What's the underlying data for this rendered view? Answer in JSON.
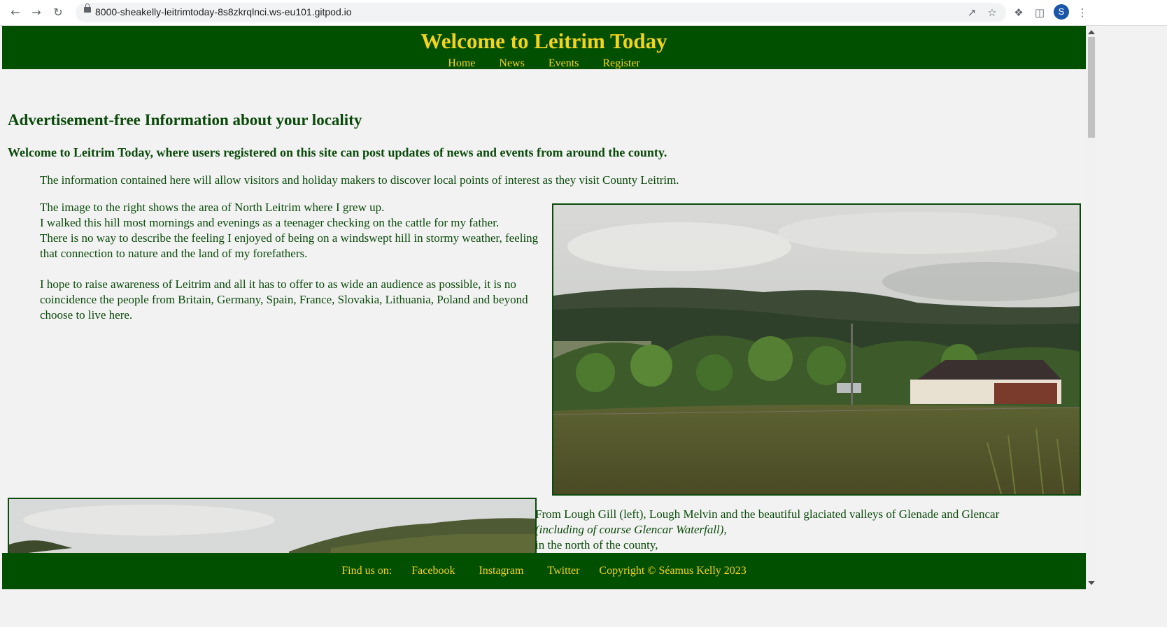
{
  "browser": {
    "url": "8000-sheakelly-leitrimtoday-8s8zkrqlnci.ws-eu101.gitpod.io",
    "avatar_letter": "S",
    "icons": [
      "back-icon",
      "forward-icon",
      "reload-icon",
      "lock-icon",
      "share-icon",
      "star-icon",
      "extensions-icon",
      "sidepanel-icon",
      "menu-icon"
    ]
  },
  "header": {
    "title": "Welcome to Leitrim Today",
    "nav": [
      "Home",
      "News",
      "Events",
      "Register"
    ]
  },
  "main": {
    "headline": "Advertisement-free Information about your locality",
    "welcome": "Welcome to Leitrim Today, where users registered on this site can post updates of news and events from around the county.",
    "info": "The information contained here will allow visitors and holiday makers to discover local points of interest as they visit County Leitrim.",
    "intro_lines": [
      "The image to the right shows the area of North Leitrim where I grew up.",
      "I walked this hill most mornings and evenings as a teenager checking on the cattle for my father.",
      "There is no way to describe the feeling I enjoyed of being on a windswept hill in stormy weather, feeling that connection to nature and the land of my forefathers."
    ],
    "awareness": "I hope to raise awareness of Leitrim and all it has to offer to as wide an audience as possible, it is no coincidence the people from Britain, Germany, Spain, France, Slovakia, Lithuania, Poland and beyond choose to live here.",
    "lower_line1": "From Lough Gill (left), Lough Melvin and the beautiful glaciated valleys of Glenade and Glencar",
    "lower_line2": "(including of course Glencar Waterfall),",
    "lower_line3": "in the north of the county,"
  },
  "footer": {
    "find_us": "Find us on:",
    "links": [
      "Facebook",
      "Instagram",
      "Twitter"
    ],
    "copyright": "Copyright © Séamus Kelly 2023"
  },
  "colors": {
    "header_bg": "#005000",
    "accent_yellow": "#f5d21e",
    "text_green": "#0b4a0b",
    "page_bg": "#f2f2f2"
  }
}
